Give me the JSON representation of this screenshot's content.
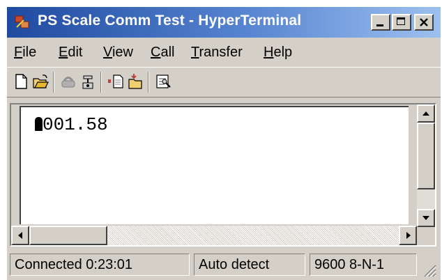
{
  "window": {
    "title": "PS Scale Comm Test - HyperTerminal"
  },
  "menu": {
    "items": [
      {
        "pre": "",
        "ul": "F",
        "post": "ile"
      },
      {
        "pre": "",
        "ul": "E",
        "post": "dit"
      },
      {
        "pre": "",
        "ul": "V",
        "post": "iew"
      },
      {
        "pre": "",
        "ul": "C",
        "post": "all"
      },
      {
        "pre": "",
        "ul": "T",
        "post": "ransfer"
      },
      {
        "pre": "",
        "ul": "H",
        "post": "elp"
      }
    ]
  },
  "toolbar": {
    "icons": [
      "new-icon",
      "open-icon",
      "disconnect-icon",
      "connect-icon",
      "send-icon",
      "receive-icon",
      "properties-icon"
    ]
  },
  "terminal": {
    "text": "001.58"
  },
  "status": {
    "connected": "Connected 0:23:01",
    "detect": "Auto detect",
    "port": "9600 8-N-1"
  }
}
